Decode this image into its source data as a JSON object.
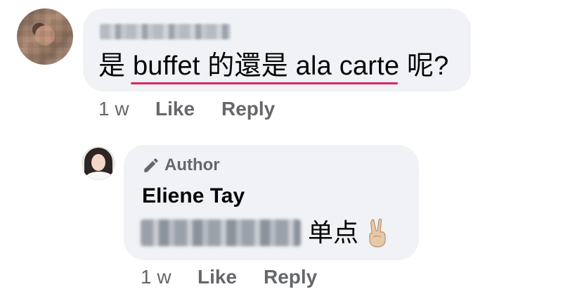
{
  "comment": {
    "author_name_blurred": true,
    "text": "是 buffet 的還是 ala carte 呢?",
    "time": "1 w",
    "like_label": "Like",
    "reply_label": "Reply"
  },
  "reply": {
    "badge_label": "Author",
    "author_name": "Eliene Tay",
    "mention_blurred": true,
    "text": "单点",
    "emoji": "victory-hand",
    "time": "1 w",
    "like_label": "Like",
    "reply_label": "Reply"
  },
  "colors": {
    "bubble": "#f0f2f5",
    "meta_text": "#65676b",
    "primary_text": "#050505",
    "spellcheck_underline": "#e0245e"
  },
  "icons": [
    "pencil-icon",
    "victory-hand-icon"
  ]
}
